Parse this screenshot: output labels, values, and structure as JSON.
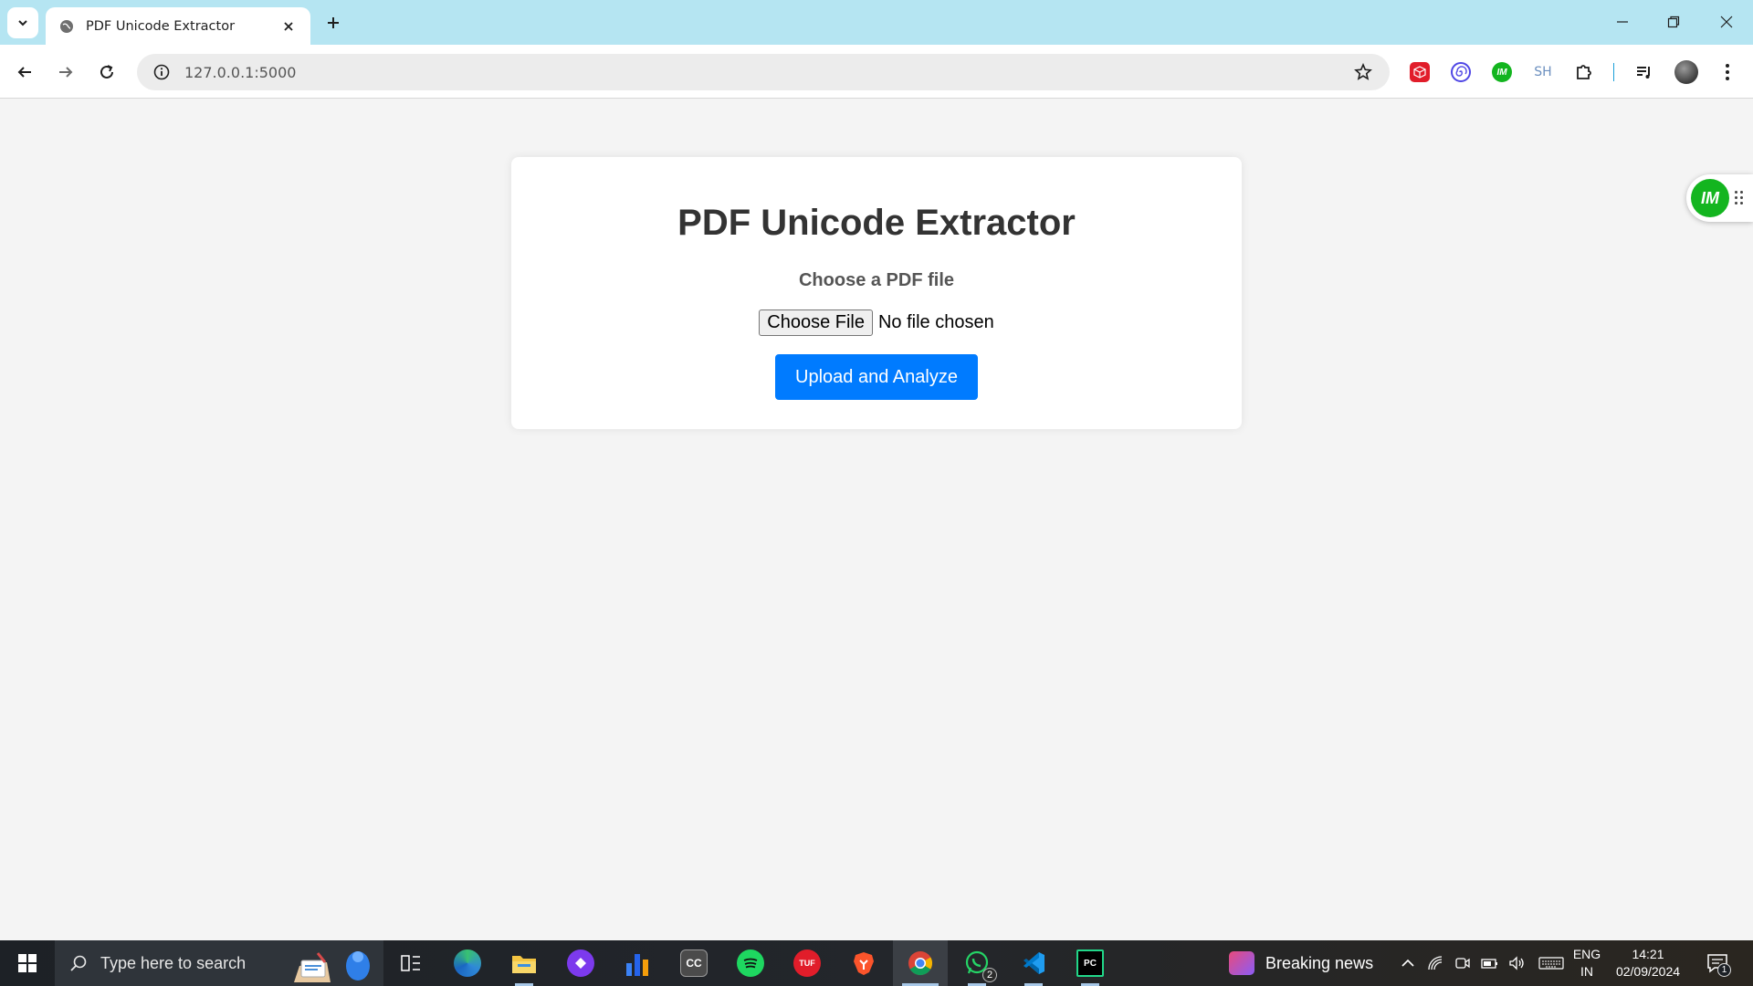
{
  "browser": {
    "tab_title": "PDF Unicode Extractor",
    "url": "127.0.0.1:5000",
    "extensions": {
      "sh_label": "SH",
      "im_label": "IM"
    }
  },
  "page": {
    "heading": "PDF Unicode Extractor",
    "file_label": "Choose a PDF file",
    "choose_file_button": "Choose File",
    "file_status": "No file chosen",
    "submit_button": "Upload and Analyze",
    "colors": {
      "accent": "#007bff",
      "background": "#f4f4f4",
      "heading": "#333333"
    }
  },
  "side_widget": {
    "label": "IM"
  },
  "taskbar": {
    "search_placeholder": "Type here to search",
    "apps": [
      {
        "name": "task-view",
        "icon": "task-view-icon"
      },
      {
        "name": "edge",
        "icon": "edge-icon"
      },
      {
        "name": "file-explorer",
        "icon": "folder-icon"
      },
      {
        "name": "app-purple",
        "icon": "purple-diamond-icon"
      },
      {
        "name": "power-bi",
        "icon": "bar-chart-icon"
      },
      {
        "name": "cc",
        "icon": "cc-icon",
        "label": "CC"
      },
      {
        "name": "spotify",
        "icon": "spotify-icon"
      },
      {
        "name": "tuf",
        "icon": "tuf-icon",
        "label": "TUF"
      },
      {
        "name": "brave",
        "icon": "brave-icon"
      },
      {
        "name": "chrome",
        "icon": "chrome-icon"
      },
      {
        "name": "whatsapp",
        "icon": "whatsapp-icon",
        "badge": "2"
      },
      {
        "name": "vscode",
        "icon": "vscode-icon"
      },
      {
        "name": "pycharm",
        "icon": "pycharm-icon",
        "label": "PC"
      }
    ],
    "news": "Breaking news",
    "language_line1": "ENG",
    "language_line2": "IN",
    "time": "14:21",
    "date": "02/09/2024",
    "notification_count": "1"
  }
}
